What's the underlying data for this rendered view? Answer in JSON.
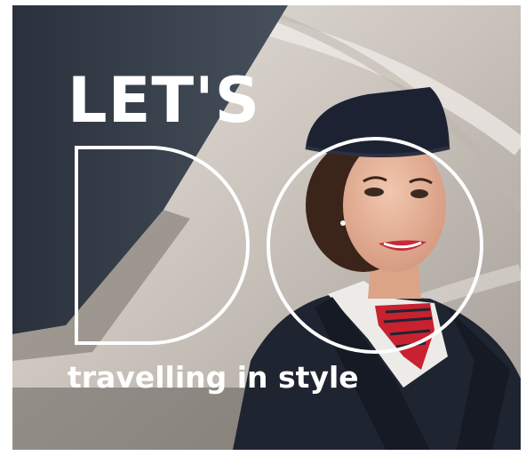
{
  "advert": {
    "headline_top": "LET'S",
    "headline_big": "DO",
    "tagline": "travelling in style"
  },
  "colors": {
    "text": "#ffffff",
    "uniform": "#1f2431",
    "tie_red": "#c8212f",
    "cabin_shadow": "#2e3540",
    "cabin_light": "#d8d2cc"
  },
  "scene": {
    "subject": "flight-attendant",
    "setting": "aircraft-cabin"
  }
}
